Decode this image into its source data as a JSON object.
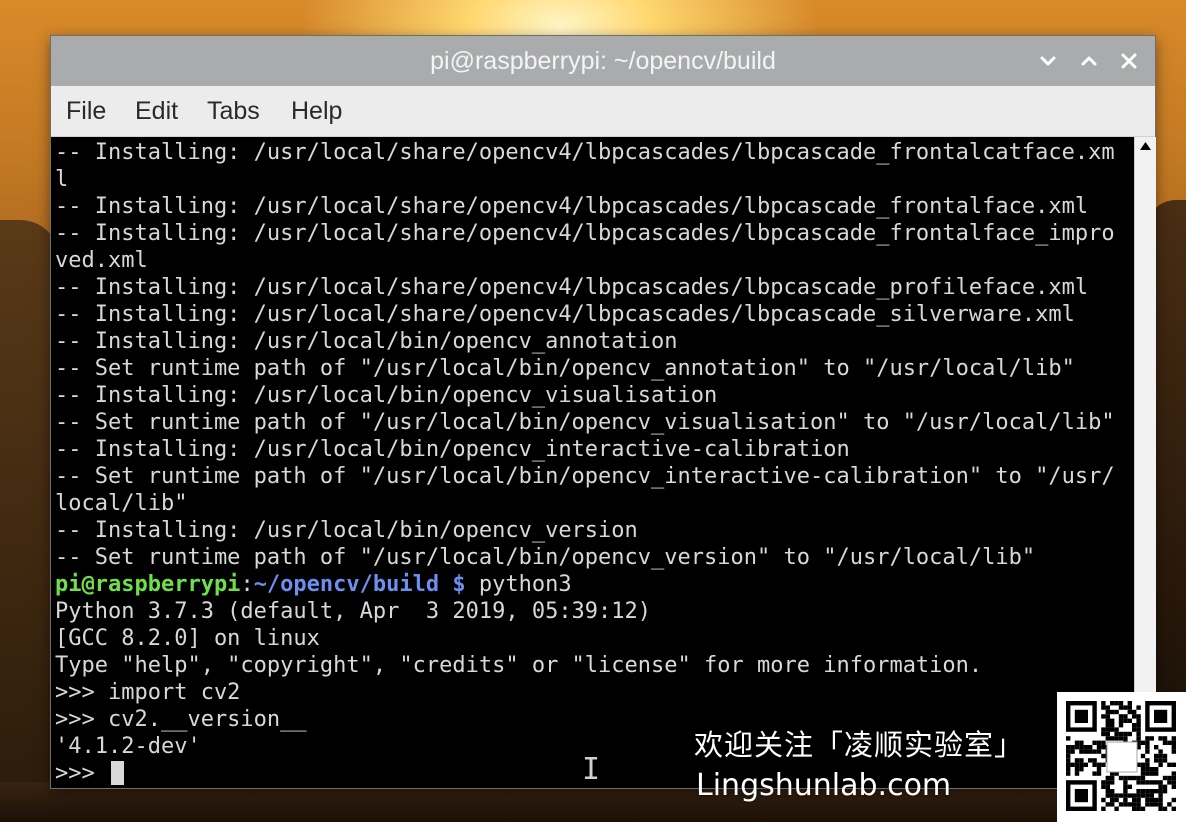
{
  "window": {
    "title": "pi@raspberrypi: ~/opencv/build",
    "controls": [
      "chevron-down-icon",
      "chevron-up-icon",
      "close-icon"
    ]
  },
  "menu": {
    "items": [
      "File",
      "Edit",
      "Tabs",
      "Help"
    ]
  },
  "terminal": {
    "lines": [
      "-- Installing: /usr/local/share/opencv4/lbpcascades/lbpcascade_frontalcatface.xm",
      "l",
      "-- Installing: /usr/local/share/opencv4/lbpcascades/lbpcascade_frontalface.xml",
      "-- Installing: /usr/local/share/opencv4/lbpcascades/lbpcascade_frontalface_impro",
      "ved.xml",
      "-- Installing: /usr/local/share/opencv4/lbpcascades/lbpcascade_profileface.xml",
      "-- Installing: /usr/local/share/opencv4/lbpcascades/lbpcascade_silverware.xml",
      "-- Installing: /usr/local/bin/opencv_annotation",
      "-- Set runtime path of \"/usr/local/bin/opencv_annotation\" to \"/usr/local/lib\"",
      "-- Installing: /usr/local/bin/opencv_visualisation",
      "-- Set runtime path of \"/usr/local/bin/opencv_visualisation\" to \"/usr/local/lib\"",
      "-- Installing: /usr/local/bin/opencv_interactive-calibration",
      "-- Set runtime path of \"/usr/local/bin/opencv_interactive-calibration\" to \"/usr/",
      "local/lib\"",
      "-- Installing: /usr/local/bin/opencv_version",
      "-- Set runtime path of \"/usr/local/bin/opencv_version\" to \"/usr/local/lib\""
    ],
    "prompt": {
      "user": "pi@raspberrypi",
      "sep": ":",
      "path": "~/opencv/build",
      "symbol": " $",
      "command": " python3"
    },
    "python_lines": [
      "Python 3.7.3 (default, Apr  3 2019, 05:39:12)",
      "[GCC 8.2.0] on linux",
      "Type \"help\", \"copyright\", \"credits\" or \"license\" for more information.",
      ">>> import cv2",
      ">>> cv2.__version__",
      "'4.1.2-dev'"
    ],
    "current_prompt": ">>> "
  },
  "watermark": {
    "chinese": "欢迎关注「凌顺实验室」",
    "url": "Lingshunlab.com",
    "qr_icon": "qr-code-icon"
  },
  "colors": {
    "prompt_user": "#6ee04a",
    "prompt_path": "#6d8ff2",
    "terminal_text": "#d8d8d8",
    "terminal_bg": "#000000",
    "titlebar": "#a9abad",
    "menubar": "#ececec"
  }
}
